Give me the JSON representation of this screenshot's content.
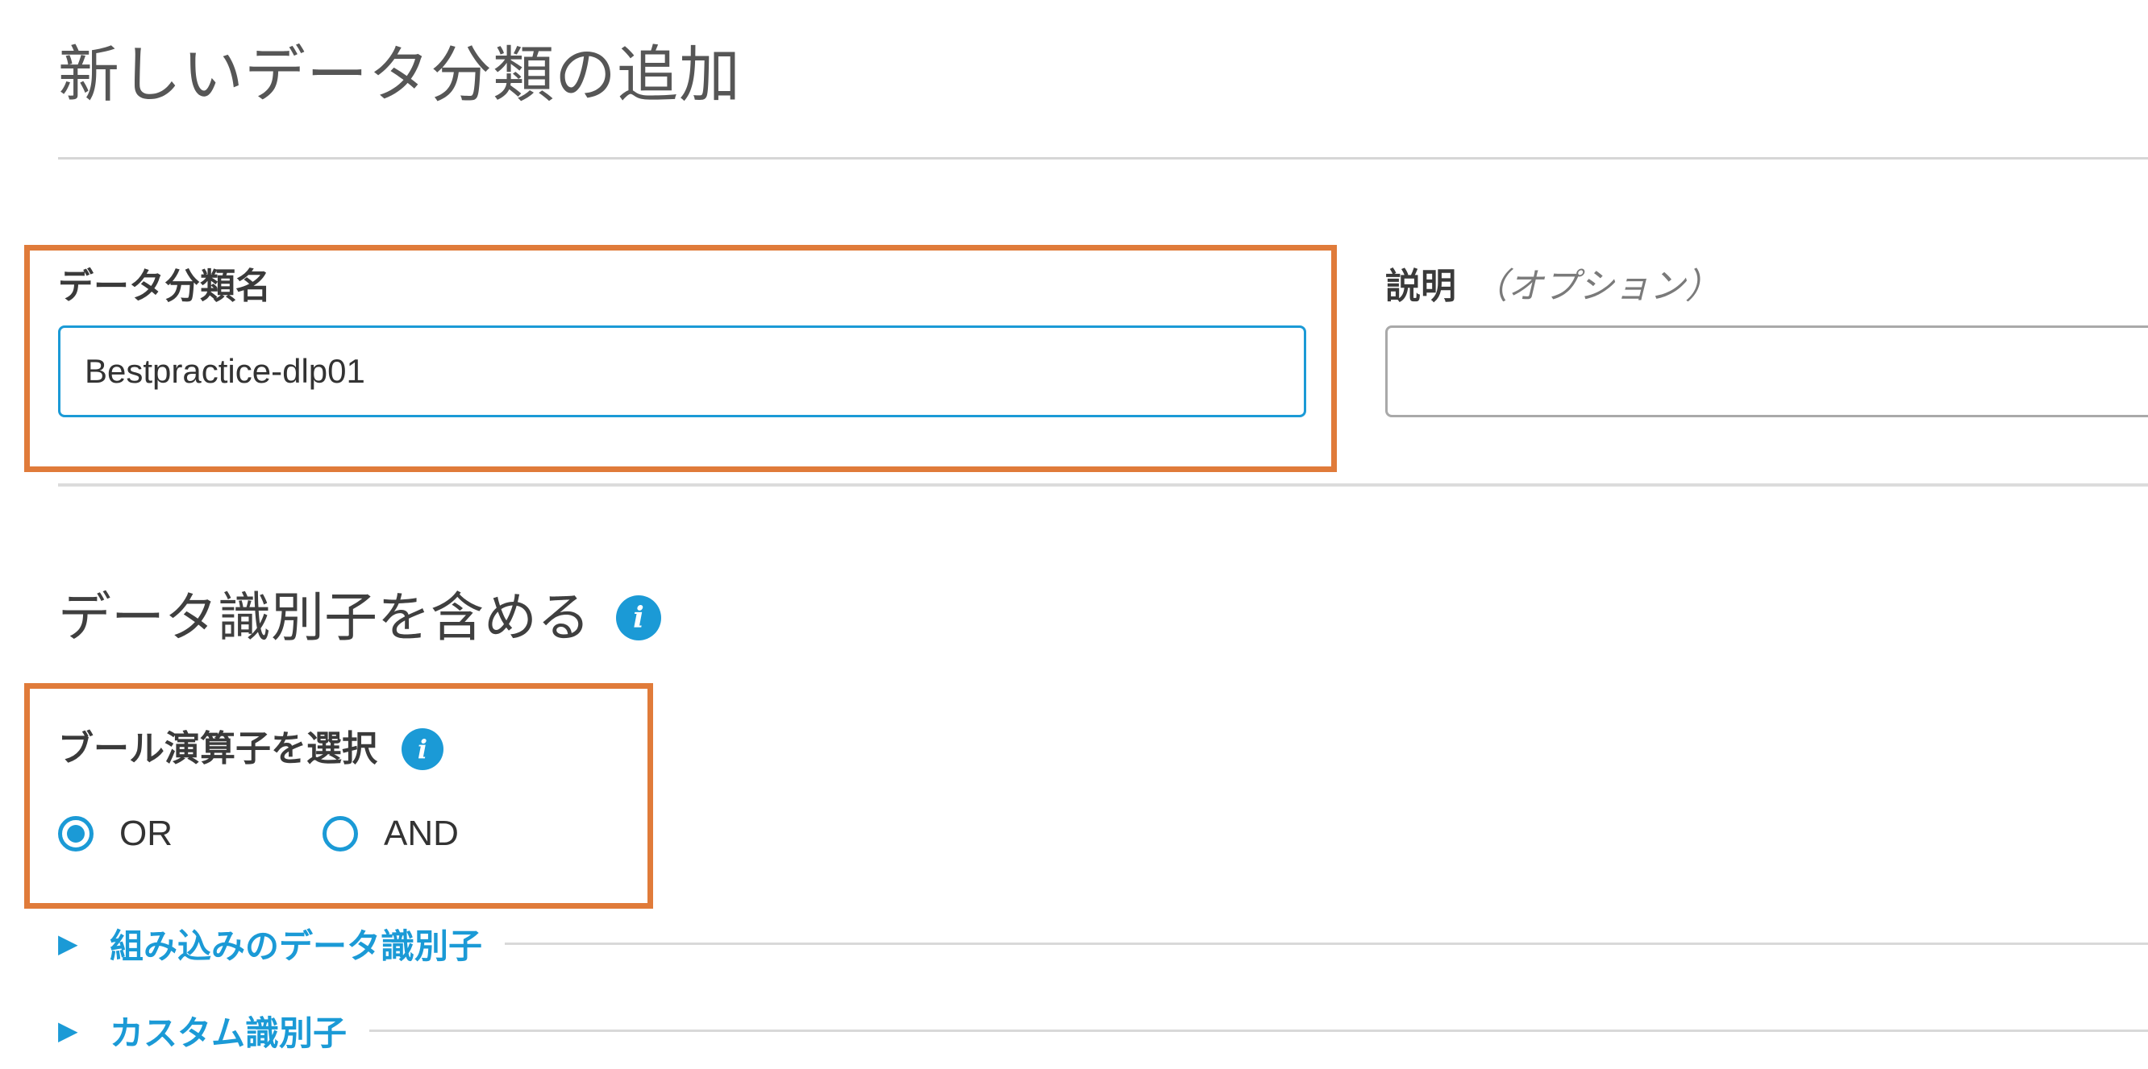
{
  "page": {
    "title": "新しいデータ分類の追加"
  },
  "form": {
    "name_label": "データ分類名",
    "name_value": "Bestpractice-dlp01",
    "description_label": "説明",
    "description_optional": "（オプション）",
    "description_value": ""
  },
  "identifiers": {
    "heading": "データ識別子を含める",
    "boolean_label": "ブール演算子を選択",
    "options": [
      {
        "label": "OR",
        "selected": true
      },
      {
        "label": "AND",
        "selected": false
      }
    ],
    "sections": [
      {
        "label": "組み込みのデータ識別子",
        "expanded": false
      },
      {
        "label": "カスタム識別子",
        "expanded": false
      }
    ]
  },
  "icons": {
    "info": "info-icon",
    "expander": "triangle-right-icon"
  },
  "colors": {
    "accent": "#1b9ad6",
    "highlight": "#e07b3a",
    "title_text": "#565656"
  }
}
